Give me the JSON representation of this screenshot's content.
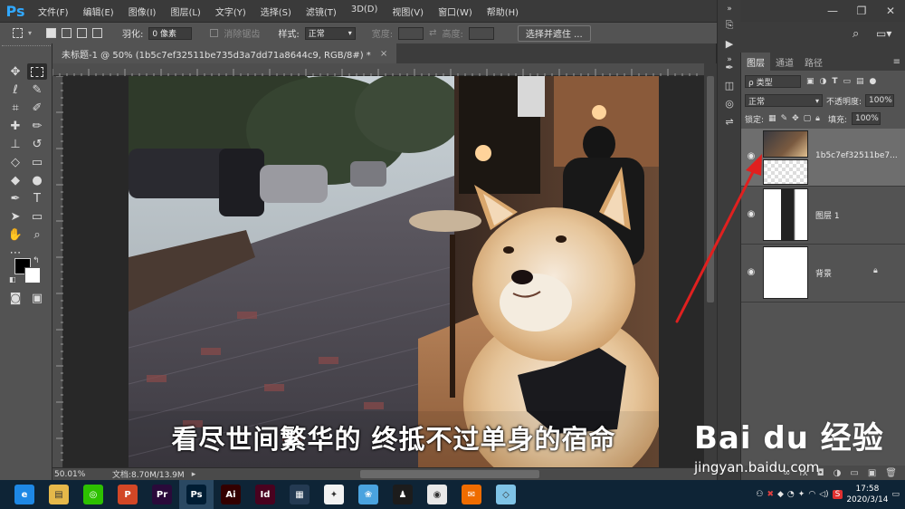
{
  "app": {
    "logo": "Ps"
  },
  "menu": [
    "文件(F)",
    "编辑(E)",
    "图像(I)",
    "图层(L)",
    "文字(Y)",
    "选择(S)",
    "滤镜(T)",
    "3D(D)",
    "视图(V)",
    "窗口(W)",
    "帮助(H)"
  ],
  "window_controls": {
    "minimize": "—",
    "restore": "❐",
    "close": "✕"
  },
  "options": {
    "feather_label": "羽化:",
    "feather_value": "0 像素",
    "antialias_label": "消除锯齿",
    "style_label": "样式:",
    "style_value": "正常",
    "width_label": "宽度:",
    "height_label": "高度:",
    "select_mask_button": "选择并遮住 ..."
  },
  "document": {
    "tab_title": "未标题-1 @ 50% (1b5c7ef32511be735d3a7dd71a8644c9, RGB/8#) *",
    "tab_close": "×",
    "caption": "看尽世间繁华的 终抵不过单身的宿命"
  },
  "status": {
    "zoom": "50.01%",
    "doc_info": "文档:8.70M/13.9M"
  },
  "layers_panel": {
    "tabs": [
      "图层",
      "通道",
      "路径"
    ],
    "kind_filter": "ρ 类型",
    "blend_mode": "正常",
    "opacity_label": "不透明度:",
    "opacity_value": "100%",
    "lock_label": "锁定:",
    "fill_label": "填充:",
    "fill_value": "100%",
    "layers": [
      {
        "name": "1b5c7ef32511be7...",
        "selected": true
      },
      {
        "name": "图层 1",
        "selected": false
      },
      {
        "name": "背景",
        "selected": false,
        "locked": true
      }
    ]
  },
  "watermark": {
    "main": "Bai du 经验",
    "url": "jingyan.baidu.com"
  },
  "taskbar": {
    "apps": [
      {
        "name": "browser-360",
        "label": "e",
        "color": "#1e88e5"
      },
      {
        "name": "file-explorer",
        "label": "▤",
        "color": "#e5b84a"
      },
      {
        "name": "wechat",
        "label": "◎",
        "color": "#2dc100"
      },
      {
        "name": "powerpoint",
        "label": "P",
        "color": "#d24726"
      },
      {
        "name": "premiere",
        "label": "Pr",
        "color": "#2a0a3a"
      },
      {
        "name": "photoshop",
        "label": "Ps",
        "color": "#001d34"
      },
      {
        "name": "illustrator",
        "label": "Ai",
        "color": "#330000"
      },
      {
        "name": "indesign",
        "label": "Id",
        "color": "#49021f"
      },
      {
        "name": "video-player",
        "label": "▦",
        "color": "#243a52"
      },
      {
        "name": "app-green-red",
        "label": "✦",
        "color": "#f2f2f2"
      },
      {
        "name": "app-bird",
        "label": "❀",
        "color": "#4aa3df"
      },
      {
        "name": "qq",
        "label": "♟",
        "color": "#1c1c1c"
      },
      {
        "name": "chrome",
        "label": "◉",
        "color": "#e8e8e8"
      },
      {
        "name": "foxmail",
        "label": "✉",
        "color": "#ef6c00"
      },
      {
        "name": "app-blue-box",
        "label": "◇",
        "color": "#7fc3e6"
      }
    ],
    "time": "17:58",
    "date": "2020/3/14",
    "input_method": "S"
  }
}
